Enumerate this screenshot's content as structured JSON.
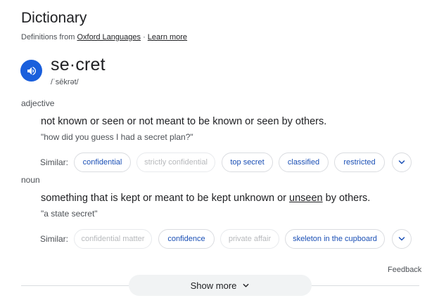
{
  "header": {
    "title": "Dictionary",
    "source_prefix": "Definitions from",
    "source_link": "Oxford Languages",
    "separator": "·",
    "learn_more": "Learn more"
  },
  "entry": {
    "word": "se·cret",
    "pronunciation": "/ˈsēkrət/",
    "speaker_icon": "speaker-icon",
    "accent_color": "#1a5fdc"
  },
  "senses": [
    {
      "part_of_speech": "adjective",
      "definition": "not known or seen or not meant to be known or seen by others.",
      "example": "\"how did you guess I had a secret plan?\"",
      "similar_label": "Similar:",
      "similar": [
        {
          "text": "confidential",
          "enabled": true
        },
        {
          "text": "strictly confidential",
          "enabled": false
        },
        {
          "text": "top secret",
          "enabled": true
        },
        {
          "text": "classified",
          "enabled": true
        },
        {
          "text": "restricted",
          "enabled": true
        }
      ]
    },
    {
      "part_of_speech": "noun",
      "definition_before": "something that is kept or meant to be kept unknown or ",
      "definition_link": "unseen",
      "definition_after": " by others.",
      "example": "\"a state secret\"",
      "similar_label": "Similar:",
      "similar": [
        {
          "text": "confidential matter",
          "enabled": false
        },
        {
          "text": "confidence",
          "enabled": true
        },
        {
          "text": "private affair",
          "enabled": false
        },
        {
          "text": "skeleton in the cupboard",
          "enabled": true
        }
      ]
    }
  ],
  "footer": {
    "feedback": "Feedback",
    "show_more": "Show more"
  }
}
